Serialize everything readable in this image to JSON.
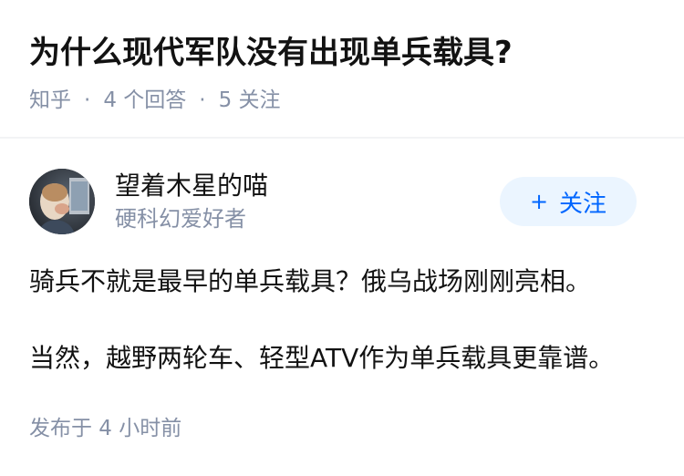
{
  "question": {
    "title": "为什么现代军队没有出现单兵载具?",
    "source": "知乎",
    "answer_count_label": "4 个回答",
    "follower_count_label": "5 关注",
    "separator": "·"
  },
  "answer": {
    "author": {
      "name": "望着木星的喵",
      "headline": "硬科幻爱好者",
      "avatar_icon": "avatar-astronaut-image"
    },
    "follow_button": {
      "plus": "+",
      "label": "关注"
    },
    "paragraphs": [
      "骑兵不就是最早的单兵载具？俄乌战场刚刚亮相。",
      "当然，越野两轮车、轻型ATV作为单兵载具更靠谱。"
    ],
    "published": "发布于 4 小时前"
  },
  "colors": {
    "text_primary": "#121212",
    "text_secondary": "#8590a6",
    "brand_blue": "#0066ff",
    "follow_bg": "#ebf5ff"
  }
}
